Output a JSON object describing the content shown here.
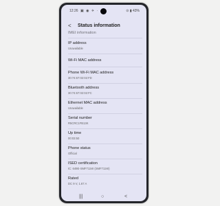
{
  "status_bar": {
    "time": "12:26",
    "notif_icons": "▣ ◉ ✈ ·",
    "right": "⊙ ▮ 43%"
  },
  "header": {
    "back": "<",
    "title": "Status information"
  },
  "rows": [
    {
      "label": "IMEI information",
      "value": ""
    },
    {
      "label": "IP address",
      "value": "Unavailable"
    },
    {
      "label": "Wi-Fi MAC address",
      "value": ""
    },
    {
      "label": "Phone Wi-Fi MAC address",
      "value": "30:74:67:02:02:FD"
    },
    {
      "label": "Bluetooth address",
      "value": "30:74:67:02:02:FC"
    },
    {
      "label": "Ethernet MAC address",
      "value": "Unavailable"
    },
    {
      "label": "Serial number",
      "value": "R5CRC1FB13K"
    },
    {
      "label": "Up time",
      "value": "00:03:50"
    },
    {
      "label": "Phone status",
      "value": "Official"
    },
    {
      "label": "ISED certification",
      "value": "IC: 649E-SMF711W (SMF711W)"
    },
    {
      "label": "Rated",
      "value": "DC 9 V, 1.67 A"
    }
  ],
  "navbar": {
    "recents": "|||",
    "home": "○",
    "back": "<"
  }
}
